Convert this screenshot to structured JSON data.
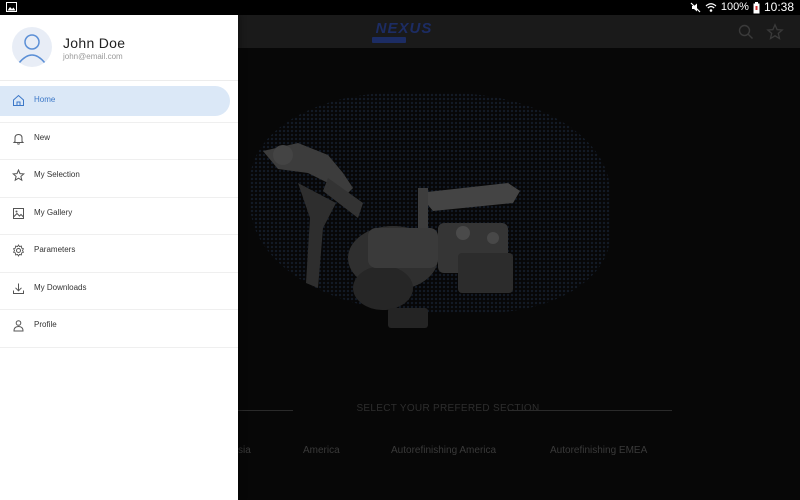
{
  "status_bar": {
    "battery": "100%",
    "time": "10:38",
    "icons": [
      "gallery-icon",
      "mute-icon",
      "wifi-icon",
      "battery-icon"
    ]
  },
  "app_bar": {
    "logo_text": "NEXUS",
    "icons": [
      "search-icon",
      "star-icon"
    ]
  },
  "drawer": {
    "user": {
      "name": "John Doe",
      "email": "john@email.com"
    },
    "items": [
      {
        "label": "Home",
        "icon": "home-icon",
        "active": true
      },
      {
        "label": "New",
        "icon": "bell-icon",
        "active": false
      },
      {
        "label": "My Selection",
        "icon": "star-icon",
        "active": false
      },
      {
        "label": "My Gallery",
        "icon": "image-icon",
        "active": false
      },
      {
        "label": "Parameters",
        "icon": "gear-icon",
        "active": false
      },
      {
        "label": "My Downloads",
        "icon": "download-icon",
        "active": false
      },
      {
        "label": "Profile",
        "icon": "person-icon",
        "active": false
      }
    ]
  },
  "main": {
    "section_title": "SELECT YOUR PREFERED SECTION",
    "regions": [
      "sia",
      "America",
      "Autorefinishing America",
      "Autorefinishing EMEA"
    ]
  },
  "colors": {
    "accent": "#3c78c8",
    "active_bg": "#dbe8f7",
    "logo": "#1c2c63"
  }
}
